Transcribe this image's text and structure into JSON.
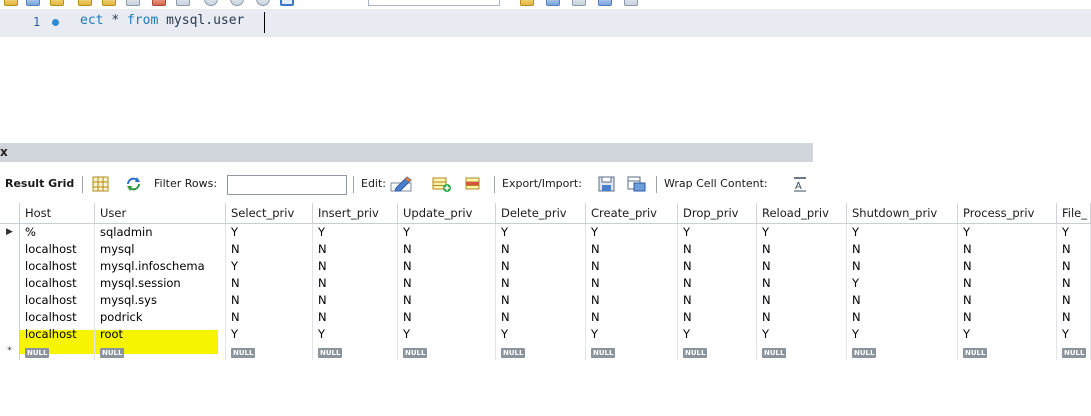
{
  "editor": {
    "line_number": "1",
    "sql_visible": {
      "keyword_fragment": "ect",
      "star": "*",
      "from_keyword": "from",
      "table": "mysql.user"
    }
  },
  "panel": {
    "close_glyph": "x"
  },
  "result_toolbar": {
    "result_grid_label": "Result Grid",
    "filter_rows_label": "Filter Rows:",
    "edit_label": "Edit:",
    "export_import_label": "Export/Import:",
    "wrap_cell_label": "Wrap Cell Content:",
    "filter_rows_value": ""
  },
  "grid": {
    "columns": [
      "Host",
      "User",
      "Select_priv",
      "Insert_priv",
      "Update_priv",
      "Delete_priv",
      "Create_priv",
      "Drop_priv",
      "Reload_priv",
      "Shutdown_priv",
      "Process_priv",
      "File_"
    ],
    "rows": [
      [
        "%",
        "sqladmin",
        "Y",
        "Y",
        "Y",
        "Y",
        "Y",
        "Y",
        "Y",
        "Y",
        "Y",
        "Y"
      ],
      [
        "localhost",
        "mysql",
        "N",
        "N",
        "N",
        "N",
        "N",
        "N",
        "N",
        "N",
        "N",
        "N"
      ],
      [
        "localhost",
        "mysql.infoschema",
        "Y",
        "N",
        "N",
        "N",
        "N",
        "N",
        "N",
        "N",
        "N",
        "N"
      ],
      [
        "localhost",
        "mysql.session",
        "N",
        "N",
        "N",
        "N",
        "N",
        "N",
        "N",
        "Y",
        "N",
        "N"
      ],
      [
        "localhost",
        "mysql.sys",
        "N",
        "N",
        "N",
        "N",
        "N",
        "N",
        "N",
        "N",
        "N",
        "N"
      ],
      [
        "localhost",
        "podrick",
        "N",
        "N",
        "N",
        "N",
        "N",
        "N",
        "N",
        "N",
        "N",
        "N"
      ],
      [
        "localhost",
        "root",
        "Y",
        "Y",
        "Y",
        "Y",
        "Y",
        "Y",
        "Y",
        "Y",
        "Y",
        "Y"
      ]
    ],
    "null_label": "NULL",
    "current_row_glyph": "▶",
    "new_row_glyph": "*",
    "highlighted_row": "podrick"
  },
  "colors": {
    "highlight": "#f6f400",
    "editor_line": "#e8ecf2",
    "keyword": "#2178b8"
  }
}
